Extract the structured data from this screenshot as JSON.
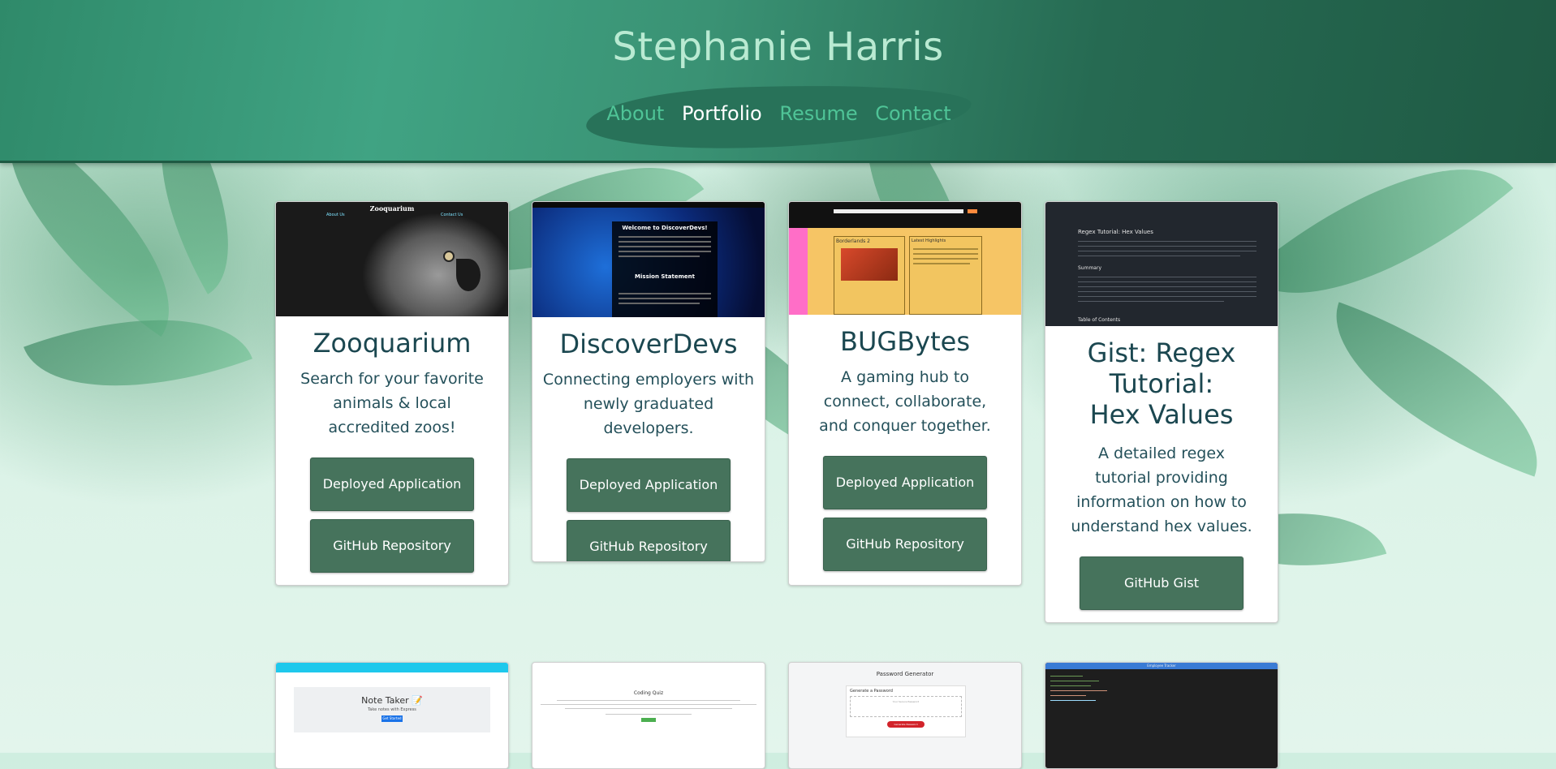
{
  "site": {
    "title": "Stephanie Harris"
  },
  "nav": [
    {
      "label": "About"
    },
    {
      "label": "Portfolio",
      "active": true
    },
    {
      "label": "Resume"
    },
    {
      "label": "Contact"
    }
  ],
  "projects": [
    {
      "title": "Zooquarium",
      "description": "Search for your favorite animals & local accredited zoos!",
      "buttons": [
        "Deployed Application",
        "GitHub Repository"
      ],
      "thumb": {
        "heading": "Zooquarium",
        "links": [
          "About Us",
          "Contact Us"
        ]
      }
    },
    {
      "title": "DiscoverDevs",
      "description": "Connecting employers with newly graduated developers.",
      "buttons": [
        "Deployed Application",
        "GitHub Repository"
      ],
      "thumb": {
        "heading": "Welcome to DiscoverDevs!",
        "subheading": "Mission Statement"
      }
    },
    {
      "title": "BUGBytes",
      "description": "A gaming hub to connect, collaborate, and conquer together.",
      "buttons": [
        "Deployed Application",
        "GitHub Repository"
      ],
      "thumb": {
        "left_label": "Borderlands 2",
        "right_label": "Latest Highlights"
      }
    },
    {
      "title": "Gist: Regex Tutorial: Hex Values",
      "description": "A detailed regex tutorial providing information on how to understand hex values.",
      "buttons": [
        "GitHub Gist"
      ],
      "thumb": {
        "heading": "Regex Tutorial: Hex Values",
        "summary": "Summary",
        "toc": "Table of Contents"
      }
    }
  ],
  "bottom_previews": [
    {
      "title": "Note Taker 📝",
      "subtitle": "Take notes with Express",
      "button": "Get Started"
    },
    {
      "title": "Coding Quiz"
    },
    {
      "title": "Password Generator",
      "heading": "Generate a Password",
      "placeholder": "Your Secure Password",
      "button": "Generate Password"
    },
    {
      "title": "Employee Tracker"
    }
  ],
  "colors": {
    "header": "#3a9274",
    "button": "#46735c",
    "card_title": "#1b4750",
    "nav_active": "#ffffff",
    "nav_link": "#4fc497"
  }
}
